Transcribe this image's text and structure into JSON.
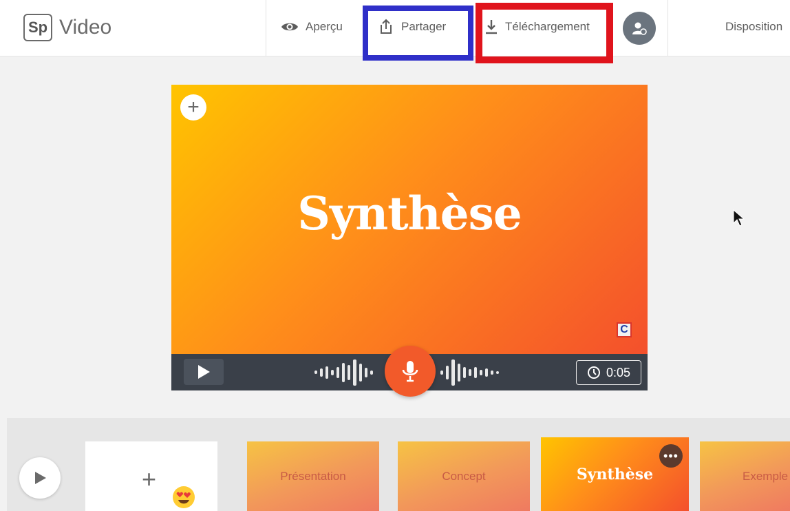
{
  "app": {
    "logo_mark": "Sp",
    "title": "Video"
  },
  "toolbar": {
    "preview_label": "Aperçu",
    "share_label": "Partager",
    "download_label": "Téléchargement",
    "layout_label": "Disposition"
  },
  "highlights": {
    "share_color": "#2f2fc8",
    "download_color": "#e0141c"
  },
  "slide": {
    "title": "Synthèse",
    "badge": "C",
    "gradient": [
      "#ffc400",
      "#ff8e1a",
      "#f4502c"
    ]
  },
  "player": {
    "duration": "0:05",
    "mic_color": "#f25a2a"
  },
  "thumbnails": [
    {
      "label": "Présentation"
    },
    {
      "label": "Concept"
    },
    {
      "label": "Synthèse"
    },
    {
      "label": "Exemple"
    }
  ],
  "icons": {
    "preview": "eye-icon",
    "share": "share-icon",
    "download": "download-icon",
    "avatar": "user-icon",
    "add": "plus-icon",
    "play": "play-icon",
    "mic": "microphone-icon",
    "timer": "clock-icon",
    "more": "more-icon",
    "emoji": "heart-eyes-emoji-icon"
  }
}
